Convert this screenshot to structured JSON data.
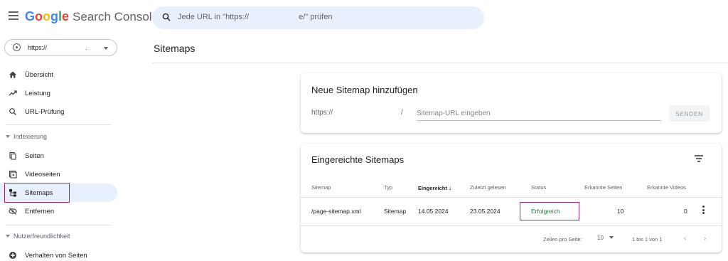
{
  "header": {
    "logo_letters": [
      "G",
      "o",
      "o",
      "g",
      "l",
      "e"
    ],
    "product": "Search Console",
    "search_prefix": "Jede URL in \"https://",
    "search_suffix": "e/\" prüfen"
  },
  "property": {
    "prefix": "https://",
    "suffix": "."
  },
  "page_title": "Sitemaps",
  "sidebar": {
    "items_top": [
      {
        "label": "Übersicht",
        "icon": "home-icon"
      },
      {
        "label": "Leistung",
        "icon": "trending-icon"
      },
      {
        "label": "URL-Prüfung",
        "icon": "search-icon"
      }
    ],
    "section_indexing": "Indexierung",
    "items_indexing": [
      {
        "label": "Seiten",
        "icon": "pages-icon"
      },
      {
        "label": "Videoseiten",
        "icon": "video-pages-icon"
      },
      {
        "label": "Sitemaps",
        "icon": "sitemap-icon"
      },
      {
        "label": "Entfernen",
        "icon": "remove-icon"
      }
    ],
    "section_ux": "Nutzerfreundlichkeit",
    "items_ux": [
      {
        "label": "Verhalten von Seiten",
        "icon": "page-behavior-icon"
      }
    ]
  },
  "add_sitemap": {
    "title": "Neue Sitemap hinzufügen",
    "url_prefix": "https://",
    "url_mid": "/",
    "placeholder": "Sitemap-URL eingeben",
    "submit_label": "SENDEN"
  },
  "submitted": {
    "title": "Eingereichte Sitemaps",
    "columns": [
      "Sitemap",
      "Typ",
      "Eingereicht",
      "Zuletzt gelesen",
      "Status",
      "Erkannte Seiten",
      "Erkannte Videos"
    ],
    "sort_arrow": "↓",
    "rows": [
      {
        "sitemap": "/page-sitemap.xml",
        "type": "Sitemap",
        "submitted": "14.05.2024",
        "last_read": "23.05.2024",
        "status": "Erfolgreich",
        "pages": "10",
        "videos": "0"
      }
    ],
    "pager": {
      "rows_label": "Zeilen pro Seite:",
      "rows_value": "10",
      "range": "1 bis 1 von 1",
      "prev": "‹",
      "next": "›"
    }
  },
  "colors": {
    "accent": "#1a73e8",
    "active_nav": "#e8f0fe",
    "success": "#188038",
    "highlight": "#a12a73"
  }
}
